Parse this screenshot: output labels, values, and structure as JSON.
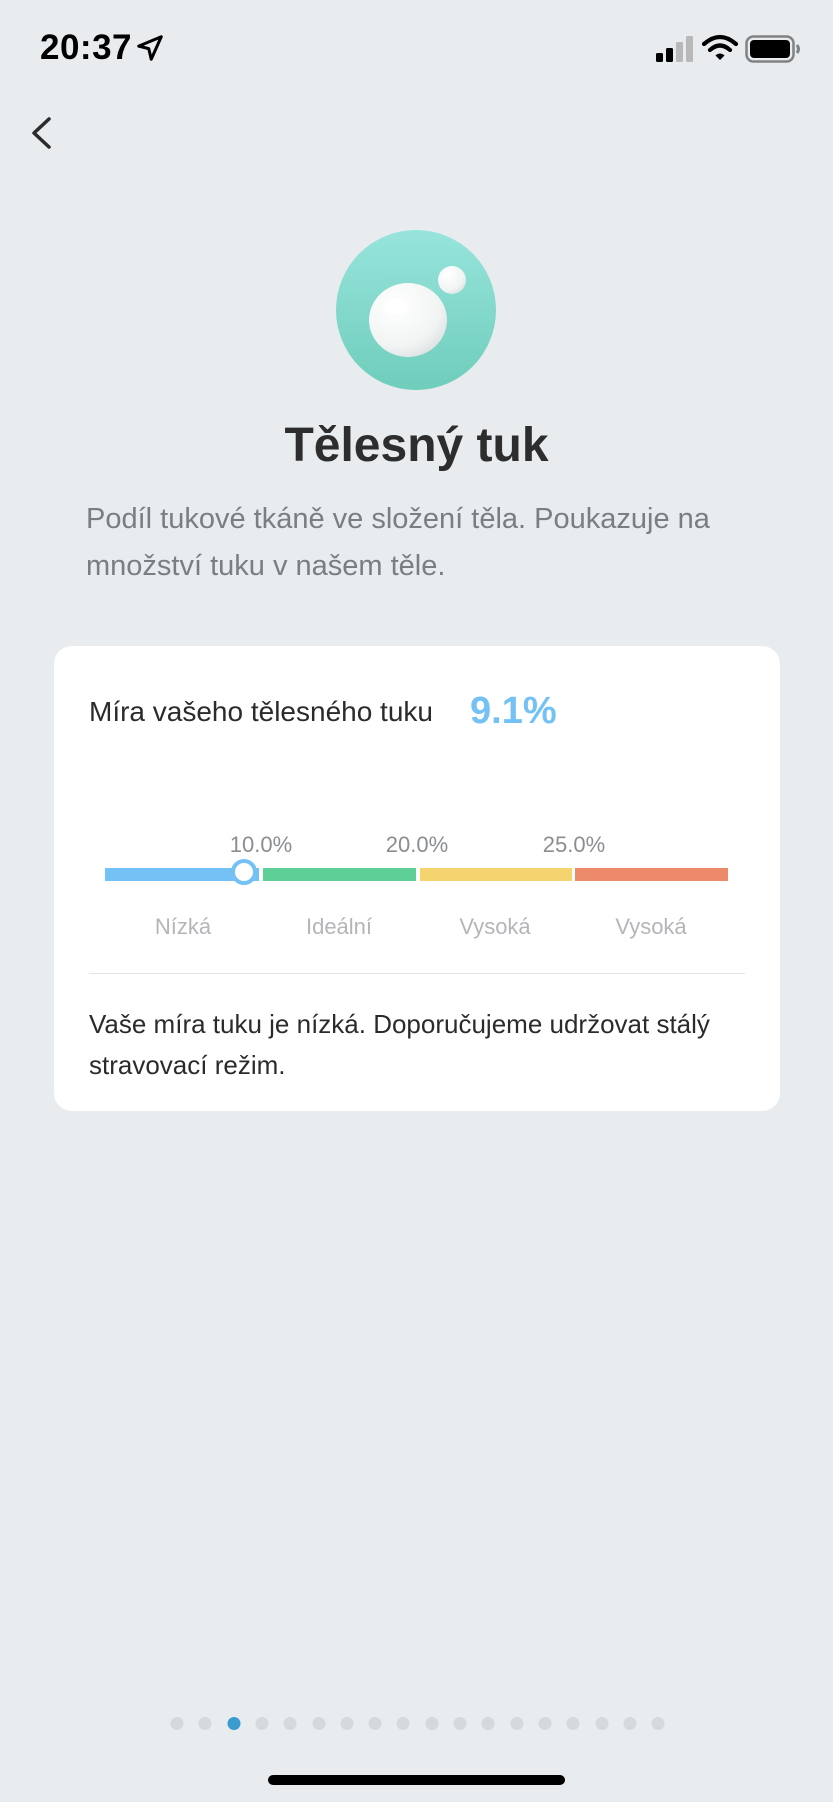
{
  "status_bar": {
    "time": "20:37",
    "icons": [
      "location-arrow-icon",
      "signal-icon",
      "wifi-icon",
      "battery-icon"
    ]
  },
  "nav": {
    "back_icon": "chevron-left-icon"
  },
  "hero": {
    "icon": "body-fat-droplet-icon",
    "color": "#7fd6c8"
  },
  "title": "Tělesný tuk",
  "description": "Podíl tukové tkáně ve složení těla. Poukazuje na množství tuku v našem těle.",
  "card": {
    "label": "Míra vašeho tělesného tuku",
    "value": "9.1%",
    "value_color": "#74c1f5",
    "scale": {
      "ticks": [
        "10.0%",
        "20.0%",
        "25.0%"
      ],
      "segments": [
        {
          "label": "Nízká",
          "color": "#74c1f5"
        },
        {
          "label": "Ideální",
          "color": "#5fcf98"
        },
        {
          "label": "Vysoká",
          "color": "#f5d46f"
        },
        {
          "label": "Vysoká",
          "color": "#ec8a6a"
        }
      ]
    },
    "note": "Vaše míra tuku je nízká. Doporučujeme udržovat stálý stravovací režim."
  },
  "pager": {
    "count": 18,
    "active_index": 2,
    "active_color": "#3a9bd1"
  }
}
